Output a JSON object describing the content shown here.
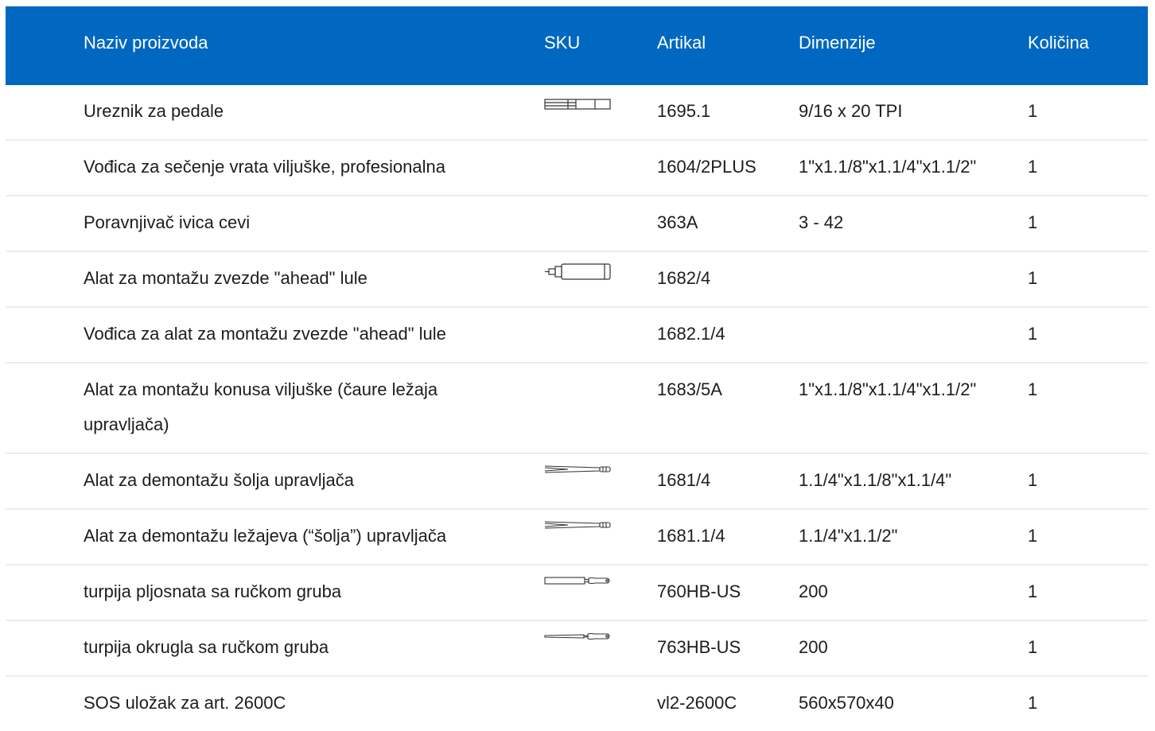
{
  "header": {
    "name": "Naziv proizvoda",
    "sku": "SKU",
    "article": "Artikal",
    "dimensions": "Dimenzije",
    "quantity": "Količina"
  },
  "rows": [
    {
      "name": "Ureznik za pedale",
      "sku_icon": "tap-tool-icon",
      "article": "1695.1",
      "dimensions": "9/16 x 20 TPI",
      "quantity": "1"
    },
    {
      "name": "Vođica za sečenje vrata viljuške, profesionalna",
      "sku_icon": "",
      "article": "1604/2PLUS",
      "dimensions": "1\"x1.1/8\"x1.1/4\"x1.1/2\"",
      "quantity": "1"
    },
    {
      "name": "Poravnjivač ivica cevi",
      "sku_icon": "",
      "article": "363A",
      "dimensions": "3 - 42",
      "quantity": "1"
    },
    {
      "name": "Alat za montažu zvezde \"ahead\" lule",
      "sku_icon": "setting-tool-icon",
      "article": "1682/4",
      "dimensions": "",
      "quantity": "1"
    },
    {
      "name": "Vođica za alat za montažu zvezde \"ahead\" lule",
      "sku_icon": "",
      "article": "1682.1/4",
      "dimensions": "",
      "quantity": "1"
    },
    {
      "name": "Alat za montažu konusa viljuške (čaure ležaja upravljača)",
      "sku_icon": "",
      "article": "1683/5A",
      "dimensions": "1\"x1.1/8\"x1.1/4\"x1.1/2\"",
      "quantity": "1"
    },
    {
      "name": "Alat za demontažu šolja upravljača",
      "sku_icon": "cup-remover-icon",
      "article": "1681/4",
      "dimensions": "1.1/4\"x1.1/8\"x1.1/4\"",
      "quantity": "1"
    },
    {
      "name": "Alat za demontažu ležajeva (“šolja”) upravljača",
      "sku_icon": "cup-remover-icon",
      "article": "1681.1/4",
      "dimensions": "1.1/4\"x1.1/2\"",
      "quantity": "1"
    },
    {
      "name": "turpija pljosnata sa ručkom gruba",
      "sku_icon": "flat-file-icon",
      "article": "760HB-US",
      "dimensions": "200",
      "quantity": "1"
    },
    {
      "name": "turpija okrugla sa ručkom gruba",
      "sku_icon": "round-file-icon",
      "article": "763HB-US",
      "dimensions": "200",
      "quantity": "1"
    },
    {
      "name": "SOS uložak za art. 2600C",
      "sku_icon": "",
      "article": "vl2-2600C",
      "dimensions": "560x570x40",
      "quantity": "1"
    }
  ]
}
